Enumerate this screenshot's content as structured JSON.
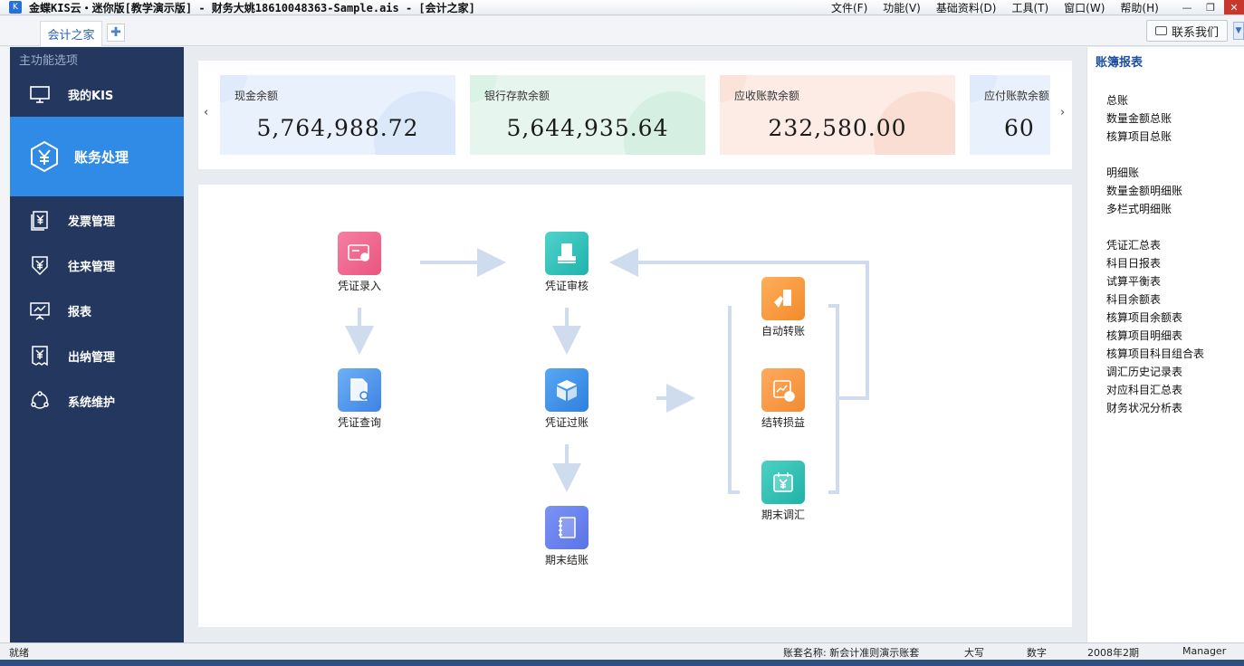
{
  "window": {
    "title": "金蝶KIS云・迷你版[教学演示版] - 财务大姚18610048363-Sample.ais - [会计之家]",
    "menus": [
      "文件(F)",
      "功能(V)",
      "基础资料(D)",
      "工具(T)",
      "窗口(W)",
      "帮助(H)"
    ],
    "controls": {
      "minimize": "—",
      "restore": "❐",
      "close": "✕"
    }
  },
  "tabs": {
    "active": "会计之家",
    "add": "✚"
  },
  "contact_button": "联系我们",
  "sidebar": {
    "header": "主功能选项",
    "items": [
      {
        "label": "我的KIS",
        "icon": "monitor-icon"
      },
      {
        "label": "账务处理",
        "icon": "yuan-hexagon-icon",
        "active": true
      },
      {
        "label": "发票管理",
        "icon": "invoice-icon"
      },
      {
        "label": "往来管理",
        "icon": "yuan-shield-icon"
      },
      {
        "label": "报表",
        "icon": "report-board-icon"
      },
      {
        "label": "出纳管理",
        "icon": "cashier-icon"
      },
      {
        "label": "系统维护",
        "icon": "system-cycle-icon"
      }
    ]
  },
  "balance_cards": [
    {
      "label": "现金余额",
      "value": "5,764,988.72",
      "color": "#e9f1fc",
      "accent": "#cfe0f8"
    },
    {
      "label": "银行存款余额",
      "value": "5,644,935.64",
      "color": "#e6f6ef",
      "accent": "#c6ead8"
    },
    {
      "label": "应收账款余额",
      "value": "232,580.00",
      "color": "#fdece5",
      "accent": "#f9d4c5"
    },
    {
      "label": "应付账款余额",
      "value": "60",
      "color": "#e9f1fc",
      "accent": "#cfe0f8"
    }
  ],
  "carousel": {
    "prev": "‹",
    "next": "›"
  },
  "workflow": {
    "voucher_entry": "凭证录入",
    "voucher_query": "凭证查询",
    "voucher_audit": "凭证审核",
    "voucher_posting": "凭证过账",
    "period_close": "期末结账",
    "auto_transfer": "自动转账",
    "profit_loss_transfer": "结转损益",
    "period_exchange_adjust": "期末调汇"
  },
  "right_panel": {
    "title": "账簿报表",
    "groups": [
      [
        "总账",
        "数量金额总账",
        "核算项目总账"
      ],
      [
        "明细账",
        "数量金额明细账",
        "多栏式明细账"
      ],
      [
        "凭证汇总表",
        "科目日报表",
        "试算平衡表",
        "科目余额表",
        "核算项目余额表",
        "核算项目明细表",
        "核算项目科目组合表",
        "调汇历史记录表",
        "对应科目汇总表",
        "财务状况分析表"
      ]
    ]
  },
  "status_bar": {
    "ready": "就绪",
    "account_set": "账套名称: 新会计准则演示账套",
    "caps": "大写",
    "num": "数字",
    "period": "2008年2期",
    "user": "Manager"
  }
}
